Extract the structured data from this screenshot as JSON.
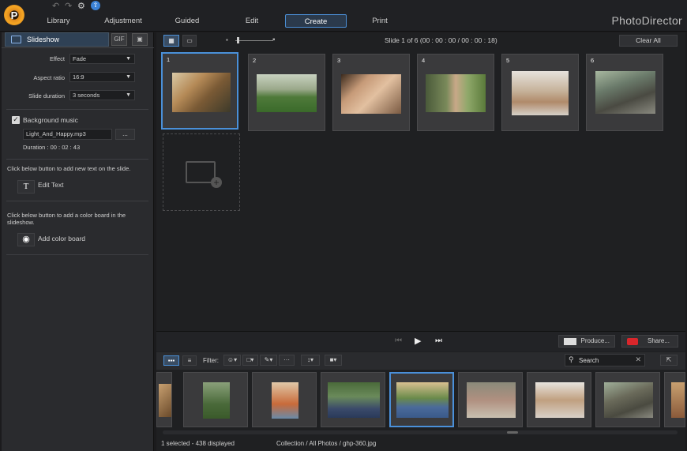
{
  "app": {
    "brand": "PhotoDirector"
  },
  "menu": {
    "tabs": [
      {
        "label": "Library"
      },
      {
        "label": "Adjustment"
      },
      {
        "label": "Guided"
      },
      {
        "label": "Edit"
      },
      {
        "label": "Create"
      },
      {
        "label": "Print"
      }
    ]
  },
  "left_panel": {
    "tab_label": "Slideshow",
    "effect_label": "Effect",
    "effect_value": "Fade",
    "aspect_label": "Aspect ratio",
    "aspect_value": "16:9",
    "duration_label": "Slide duration",
    "duration_value": "3 seconds",
    "bg_music_label": "Background music",
    "music_file": "Light_And_Happy.mp3",
    "browse_label": "...",
    "music_duration": "Duration : 00 : 02 : 43",
    "text_hint": "Click below button to add new text on the slide.",
    "edit_text_label": "Edit Text",
    "color_hint": "Click below button to add a color board in the slideshow.",
    "add_color_label": "Add color board"
  },
  "storyboard": {
    "slide_info": "Slide   1 of   6 (00 : 00 : 00 / 00 : 00 : 18)",
    "clear_all": "Clear All",
    "slides": [
      {
        "n": "1"
      },
      {
        "n": "2"
      },
      {
        "n": "3"
      },
      {
        "n": "4"
      },
      {
        "n": "5"
      },
      {
        "n": "6"
      }
    ]
  },
  "playback": {
    "produce_label": "Produce...",
    "share_label": "Share..."
  },
  "browser": {
    "filter_label": "Filter:",
    "search_placeholder": "Search",
    "status_selected": "1 selected - 438 displayed",
    "status_path": "Collection / All Photos / ghp-360.jpg"
  },
  "colors": {
    "accent": "#4a90d9",
    "active_tab_bg": "#2b3a4c",
    "logo": "#f5a623",
    "share_red": "#d9262b"
  }
}
